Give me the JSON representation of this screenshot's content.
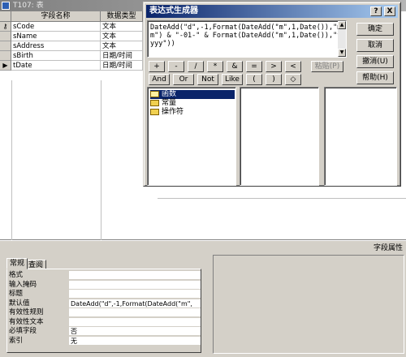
{
  "window": {
    "title": "T107: 表"
  },
  "grid": {
    "headers": [
      "字段名称",
      "数据类型"
    ],
    "rows": [
      {
        "name": "sCode",
        "type": "文本",
        "key": true
      },
      {
        "name": "sName",
        "type": "文本"
      },
      {
        "name": "sAddress",
        "type": "文本"
      },
      {
        "name": "sBirth",
        "type": "日期/时间"
      },
      {
        "name": "tDate",
        "type": "日期/时间",
        "current": true
      }
    ]
  },
  "bottom": {
    "pane_title": "字段属性",
    "tabs": [
      "常规",
      "查阅"
    ],
    "props": [
      {
        "label": "格式",
        "value": ""
      },
      {
        "label": "输入掩码",
        "value": ""
      },
      {
        "label": "标题",
        "value": ""
      },
      {
        "label": "默认值",
        "value": "DateAdd(\"d\",-1,Format(DateAdd(\"m\","
      },
      {
        "label": "有效性规则",
        "value": ""
      },
      {
        "label": "有效性文本",
        "value": ""
      },
      {
        "label": "必填字段",
        "value": "否"
      },
      {
        "label": "索引",
        "value": "无"
      }
    ]
  },
  "dialog": {
    "title": "表达式生成器",
    "help_caption": "?",
    "close_caption": "X",
    "expression": "DateAdd(\"d\",-1,Format(DateAdd(\"m\",1,Date()),\"mm\") & \"-01-\" & Format(DateAdd(\"m\",1,Date()),\"yyyy\"))",
    "operators": [
      "+",
      "-",
      "/",
      "*",
      "&",
      "=",
      ">",
      "<"
    ],
    "paste_label": "粘贴(P)",
    "logic": [
      "And",
      "Or",
      "Not",
      "Like",
      "(",
      ")",
      "◇"
    ],
    "buttons": {
      "ok": "确定",
      "cancel": "取消",
      "undo": "撤消(U)",
      "help": "帮助(H)"
    },
    "tree": [
      "函数",
      "常量",
      "操作符"
    ]
  }
}
